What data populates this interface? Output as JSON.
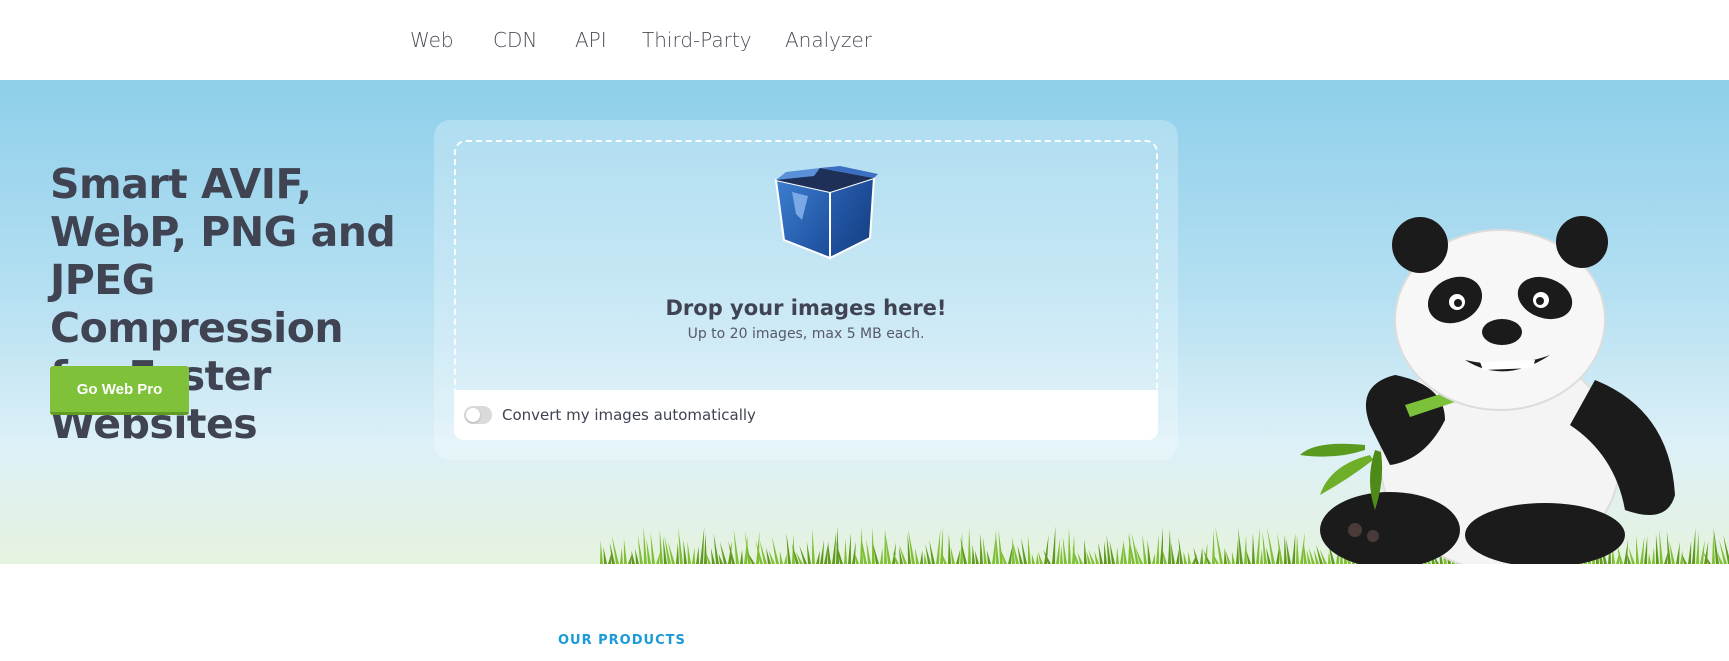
{
  "nav": {
    "items": [
      {
        "label": "Web"
      },
      {
        "label": "CDN"
      },
      {
        "label": "API"
      },
      {
        "label": "Third-Party"
      },
      {
        "label": "Analyzer"
      }
    ]
  },
  "hero": {
    "headline": "Smart AVIF, WebP, PNG and JPEG Compression for Faster Websites",
    "cta_label": "Go Web Pro"
  },
  "dropzone": {
    "title": "Drop your images here!",
    "subtitle": "Up to 20 images, max 5 MB each.",
    "convert_label": "Convert my images automatically",
    "convert_enabled": false,
    "icon": "box-icon"
  },
  "products": {
    "label": "OUR PRODUCTS"
  },
  "colors": {
    "accent_green": "#7fc23a",
    "sky_top": "#8ecfea",
    "products_blue": "#1a9ad6",
    "text_dark": "#3f4352"
  }
}
